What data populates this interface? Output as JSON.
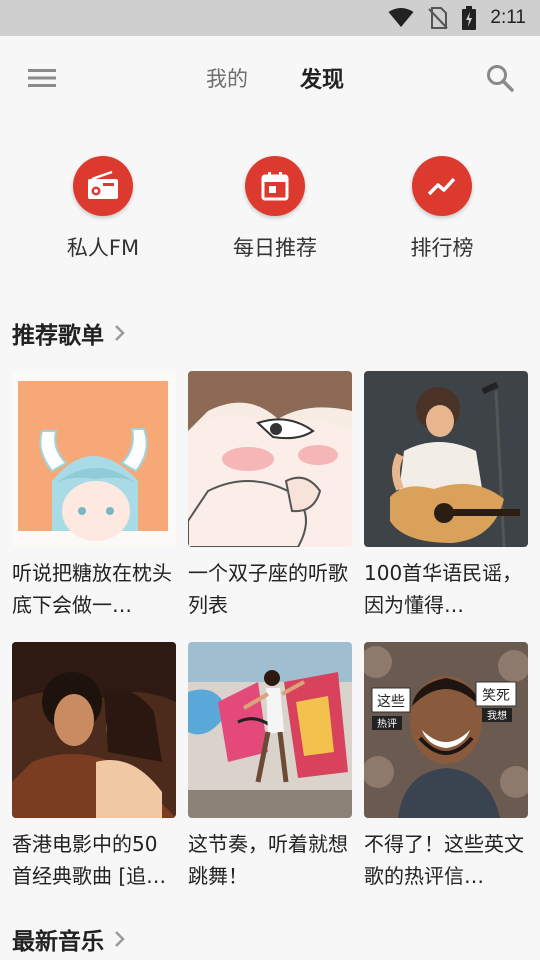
{
  "status_bar": {
    "time": "2:11",
    "icons": [
      "wifi-icon",
      "no-sim-icon",
      "battery-icon"
    ]
  },
  "header": {
    "menu_icon": "menu-icon",
    "search_icon": "search-icon",
    "tabs": [
      {
        "label": "我的",
        "active": false
      },
      {
        "label": "发现",
        "active": true
      }
    ]
  },
  "quick_entries": [
    {
      "label": "私人FM",
      "icon": "radio-icon"
    },
    {
      "label": "每日推荐",
      "icon": "calendar-icon"
    },
    {
      "label": "排行榜",
      "icon": "trending-icon"
    }
  ],
  "recommend": {
    "title": "推荐歌单",
    "playlists": [
      {
        "name": "听说把糖放在枕头底下会做一…"
      },
      {
        "name": "一个双子座的听歌列表"
      },
      {
        "name": "100首华语民谣，因为懂得…"
      },
      {
        "name": "香港电影中的50首经典歌曲 [追…"
      },
      {
        "name": "这节奏，听着就想跳舞！"
      },
      {
        "name": "不得了！这些英文歌的热评信…"
      }
    ],
    "cover_tags": [
      "这些",
      "热评",
      "笑死",
      "我想"
    ]
  },
  "new_music": {
    "title": "最新音乐"
  },
  "colors": {
    "accent": "#dd3a2f",
    "background": "#f7f7f7",
    "status_bar": "#cfcfcf"
  }
}
